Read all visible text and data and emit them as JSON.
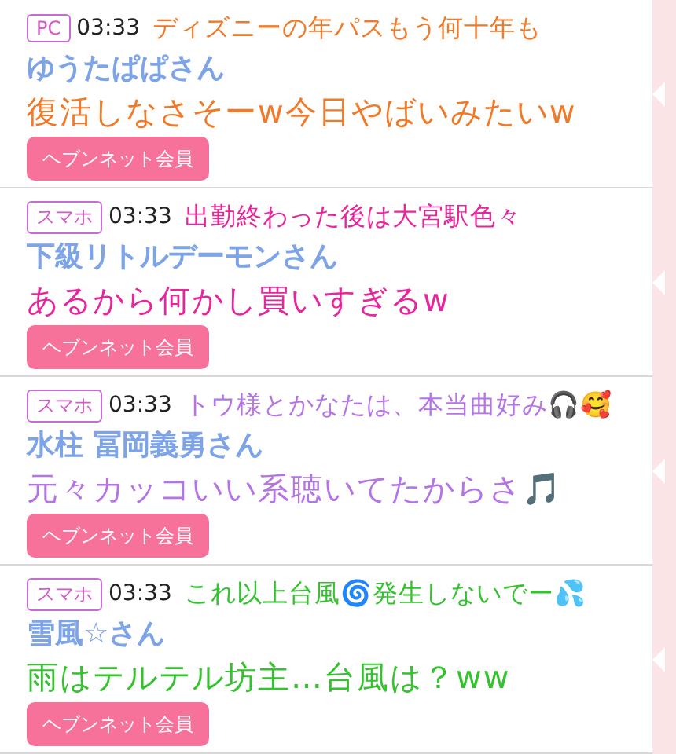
{
  "comments": [
    {
      "device": "PC",
      "time": "03:33",
      "user": "ゆうたぱぱさん",
      "member_button": "ヘブンネット会員",
      "overlay": {
        "color": "#f07a28",
        "lines": [
          "ディズニーの年パスもう何十年も",
          "復活しなさそーw今日やばいみたいw"
        ]
      }
    },
    {
      "device": "スマホ",
      "time": "03:33",
      "user": "下級リトルデーモンさん",
      "member_button": "ヘブンネット会員",
      "overlay": {
        "color": "#e8259c",
        "lines": [
          "出勤終わった後は大宮駅色々",
          "あるから何かし買いすぎるw"
        ]
      }
    },
    {
      "device": "スマホ",
      "time": "03:33",
      "user": "水柱 冨岡義勇さん",
      "member_button": "ヘブンネット会員",
      "overlay": {
        "color": "#b574e6",
        "lines": [
          "トウ様とかなたは、本当曲好み🎧🥰",
          "元々カッコいい系聴いてたからさ🎵"
        ]
      }
    },
    {
      "device": "スマホ",
      "time": "03:33",
      "user": "雪風☆さん",
      "member_button": "ヘブンネット会員",
      "overlay": {
        "color": "#34c22e",
        "lines": [
          "これ以上台風🌀発生しないでー💦",
          "雨はテルテル坊主…台風は？ww"
        ]
      }
    }
  ]
}
